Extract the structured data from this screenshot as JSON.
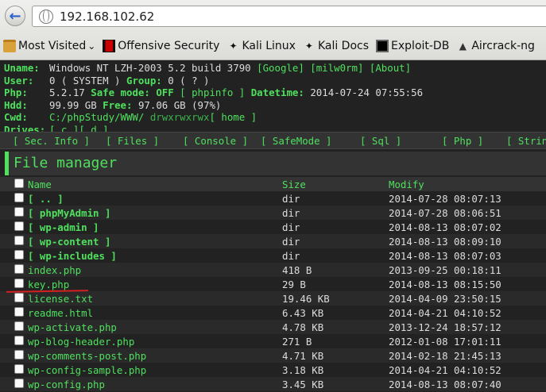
{
  "browser": {
    "url": "192.168.102.62",
    "bookmarks": [
      {
        "label": "Most Visited",
        "icon": "folder-icon"
      },
      {
        "label": "Offensive Security",
        "icon": "offsec-icon"
      },
      {
        "label": "Kali Linux",
        "icon": "kali-dragon-icon"
      },
      {
        "label": "Kali Docs",
        "icon": "kali-dragon-icon"
      },
      {
        "label": "Exploit-DB",
        "icon": "exploitdb-icon"
      },
      {
        "label": "Aircrack-ng",
        "icon": "aircrack-icon"
      }
    ],
    "bookmark_dropdown_glyph": "⌄"
  },
  "info": {
    "uname_label": "Uname:",
    "uname_value": "Windows NT LZH-2003 5.2 build 3790",
    "uname_links": [
      "[Google]",
      "[milw0rm]",
      "[About]"
    ],
    "user_label": "User:",
    "user_value": "0 ( SYSTEM )",
    "group_label": "Group:",
    "group_value": "0 ( ? )",
    "php_label": "Php:",
    "php_value": "5.2.17",
    "safe_mode_label": "Safe mode:",
    "safe_mode_value": "OFF",
    "phpinfo_link": "[ phpinfo ]",
    "datetime_label": "Datetime:",
    "datetime_value": "2014-07-24 07:55:56",
    "hdd_label": "Hdd:",
    "hdd_value": "99.99 GB",
    "free_label": "Free:",
    "free_value": "97.06 GB (97%)",
    "cwd_label": "Cwd:",
    "cwd_path": "C:/phpStudy/WWW/",
    "cwd_perms": "drwxrwxrwx",
    "cwd_home": "[ home ]",
    "drives_label": "Drives:",
    "drives": [
      "[ c ]",
      "[ d ]"
    ]
  },
  "menu": [
    "[ Sec. Info ]",
    "[ Files ]",
    "[ Console ]",
    "[ SafeMode ]",
    "[ Sql ]",
    "[ Php ]",
    "[ String"
  ],
  "file_manager": {
    "title": "File manager",
    "columns": [
      "Name",
      "Size",
      "Modify"
    ],
    "rows": [
      {
        "name": "[ .. ]",
        "size": "dir",
        "modify": "2014-07-28 08:07:13",
        "dir": true
      },
      {
        "name": "[ phpMyAdmin ]",
        "size": "dir",
        "modify": "2014-07-28 08:06:51",
        "dir": true
      },
      {
        "name": "[ wp-admin ]",
        "size": "dir",
        "modify": "2014-08-13 08:07:02",
        "dir": true
      },
      {
        "name": "[ wp-content ]",
        "size": "dir",
        "modify": "2014-08-13 08:09:10",
        "dir": true
      },
      {
        "name": "[ wp-includes ]",
        "size": "dir",
        "modify": "2014-08-13 08:07:03",
        "dir": true
      },
      {
        "name": "index.php",
        "size": "418 B",
        "modify": "2013-09-25 00:18:11",
        "dir": false
      },
      {
        "name": "key.php",
        "size": "29 B",
        "modify": "2014-08-13 08:15:50",
        "dir": false
      },
      {
        "name": "license.txt",
        "size": "19.46 KB",
        "modify": "2014-04-09 23:50:15",
        "dir": false
      },
      {
        "name": "readme.html",
        "size": "6.43 KB",
        "modify": "2014-04-21 04:10:52",
        "dir": false
      },
      {
        "name": "wp-activate.php",
        "size": "4.78 KB",
        "modify": "2013-12-24 18:57:12",
        "dir": false
      },
      {
        "name": "wp-blog-header.php",
        "size": "271 B",
        "modify": "2012-01-08 17:01:11",
        "dir": false
      },
      {
        "name": "wp-comments-post.php",
        "size": "4.71 KB",
        "modify": "2014-02-18 21:45:13",
        "dir": false
      },
      {
        "name": "wp-config-sample.php",
        "size": "3.18 KB",
        "modify": "2014-04-21 04:10:52",
        "dir": false
      },
      {
        "name": "wp-config.php",
        "size": "3.45 KB",
        "modify": "2014-08-13 08:07:40",
        "dir": false
      }
    ]
  },
  "colors": {
    "accent_green": "#4fe05e",
    "background": "#222222",
    "annotation_red": "#d42020"
  }
}
